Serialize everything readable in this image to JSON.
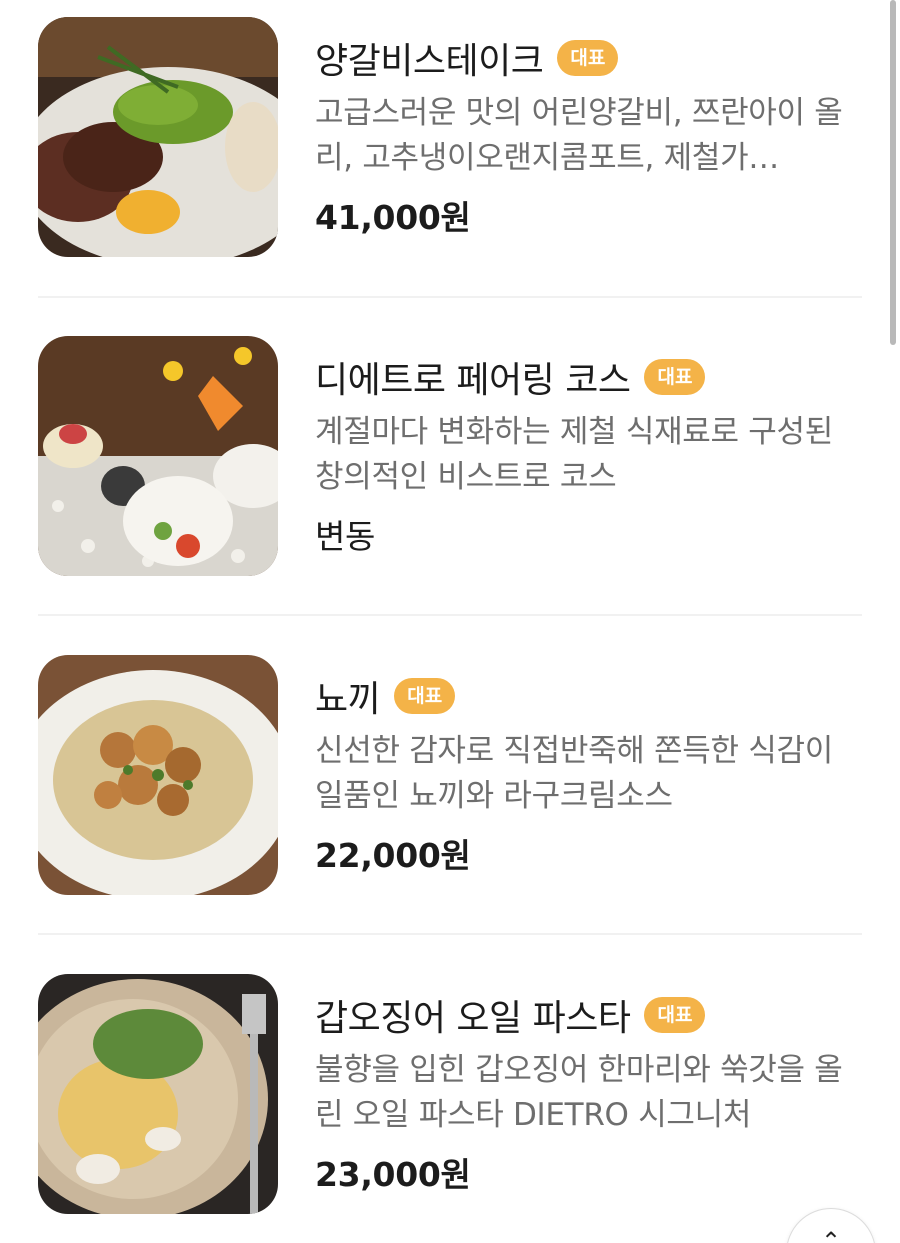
{
  "menu": {
    "badge_label": "대표",
    "items": [
      {
        "name": "양갈비스테이크",
        "description": "고급스러운 맛의 어린양갈비, 쯔란아이 올리, 고추냉이오랜지콤포트, 제철가…",
        "price": "41,000원",
        "image_icon": "lamb-steak-photo"
      },
      {
        "name": "디에트로 페어링 코스",
        "description": "계절마다 변화하는 제철 식재료로 구성된 창의적인 비스트로 코스",
        "price": "변동",
        "image_icon": "pairing-course-photo"
      },
      {
        "name": "뇨끼",
        "description": "신선한 감자로 직접반죽해 쫀득한 식감이 일품인 뇨끼와 라구크림소스",
        "price": "22,000원",
        "image_icon": "gnocchi-photo"
      },
      {
        "name": "갑오징어 오일 파스타",
        "description": "불향을 입힌 갑오징어 한마리와 쑥갓을 올린 오일 파스타 DIETRO 시그니처",
        "price": "23,000원",
        "image_icon": "squid-pasta-photo"
      }
    ]
  },
  "scroll_top_button": {
    "icon": "chevron-up-icon",
    "glyph": "⌃"
  },
  "colors": {
    "badge": "#f4b348",
    "title": "#1c1c1c",
    "description": "#6e6e6e"
  }
}
